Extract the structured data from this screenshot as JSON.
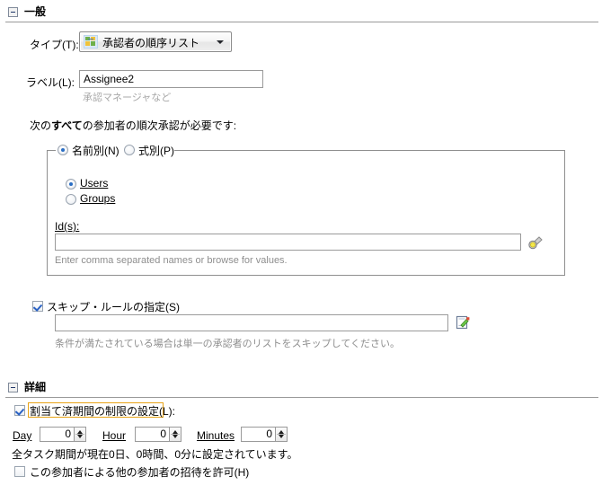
{
  "sections": {
    "general": {
      "title": "一般",
      "expander_icon": "minus-box-icon",
      "type_label": "タイプ(T):",
      "type_value": "承認者の順序リスト",
      "type_icon": "ordered-approver-list-icon",
      "dropdown_icon": "chevron-down-icon",
      "label_label": "ラベル(L):",
      "label_value": "Assignee2",
      "label_hint": "承認マネージャなど",
      "participants_text_prefix": "次の",
      "participants_text_bold": "すべて",
      "participants_text_suffix": "の参加者の順次承認が必要です:",
      "group": {
        "radio_by_name": "名前別(N)",
        "radio_by_expression": "式別(P)",
        "radio_by_name_selected": true,
        "radio_users": "Users",
        "radio_groups": "Groups",
        "radio_users_selected": true,
        "ids_label": "Id(s):",
        "ids_value": "",
        "ids_hint": "Enter comma separated names or browse for values.",
        "browse_icon": "flashlight-browse-icon"
      },
      "skip_rule": {
        "checkbox_label": "スキップ・ルールの指定(S)",
        "checked": true,
        "value": "",
        "hint": "条件が満たされている場合は単一の承認者のリストをスキップしてください。",
        "edit_icon": "edit-document-icon"
      }
    },
    "details": {
      "title": "詳細",
      "expander_icon": "minus-box-icon",
      "duration_checkbox_label": "割当て済期間の制限の設定(L):",
      "duration_checked": true,
      "duration_focused": true,
      "spinners": [
        {
          "label": "Day",
          "value": "0",
          "accel": "D"
        },
        {
          "label": "Hour",
          "value": "0",
          "accel": "H"
        },
        {
          "label": "Minutes",
          "value": "0",
          "accel": "M"
        }
      ],
      "summary": "全タスク期間が現在0日、0時間、0分に設定されています。",
      "invite_checkbox_label": "この参加者による他の参加者の招待を許可(H)",
      "invite_checked": false
    }
  },
  "colors": {
    "focus_outline": "#e8a317",
    "rule": "#9a9a9a",
    "hint_text": "#8e8e8e",
    "accent_check": "#2a62c4"
  }
}
